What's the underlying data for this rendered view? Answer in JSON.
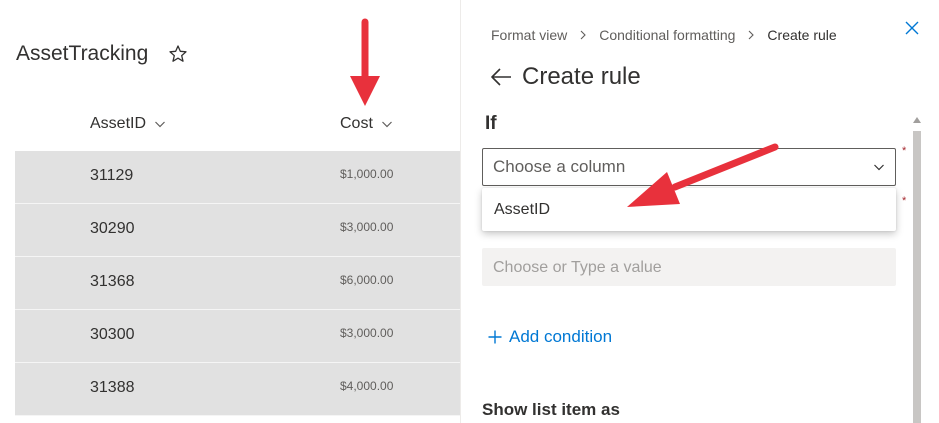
{
  "list": {
    "title": "AssetTracking",
    "columns": {
      "assetid": "AssetID",
      "cost": "Cost"
    },
    "rows": [
      {
        "assetid": "31129",
        "cost": "$1,000.00"
      },
      {
        "assetid": "30290",
        "cost": "$3,000.00"
      },
      {
        "assetid": "31368",
        "cost": "$6,000.00"
      },
      {
        "assetid": "30300",
        "cost": "$3,000.00"
      },
      {
        "assetid": "31388",
        "cost": "$4,000.00"
      }
    ]
  },
  "panel": {
    "breadcrumb": [
      "Format view",
      "Conditional formatting",
      "Create rule"
    ],
    "title": "Create rule",
    "if_label": "If",
    "column_dropdown": {
      "placeholder": "Choose a column",
      "required_mark": "*"
    },
    "dropdown_options": [
      "AssetID"
    ],
    "value_input": {
      "placeholder": "Choose or Type a value",
      "required_mark": "*"
    },
    "add_condition": "Add condition",
    "show_label": "Show list item as"
  },
  "icons": {
    "favorite": "star-icon",
    "sort": "chevron-down-icon",
    "breadcrumb_separator": "chevron-right-icon",
    "close": "close-icon",
    "back": "arrow-left-icon",
    "add": "plus-icon"
  },
  "colors": {
    "accent": "#0078d4",
    "row_background": "#e1e1e1",
    "annotation_arrow": "#e8313c",
    "required": "#a4262c"
  }
}
